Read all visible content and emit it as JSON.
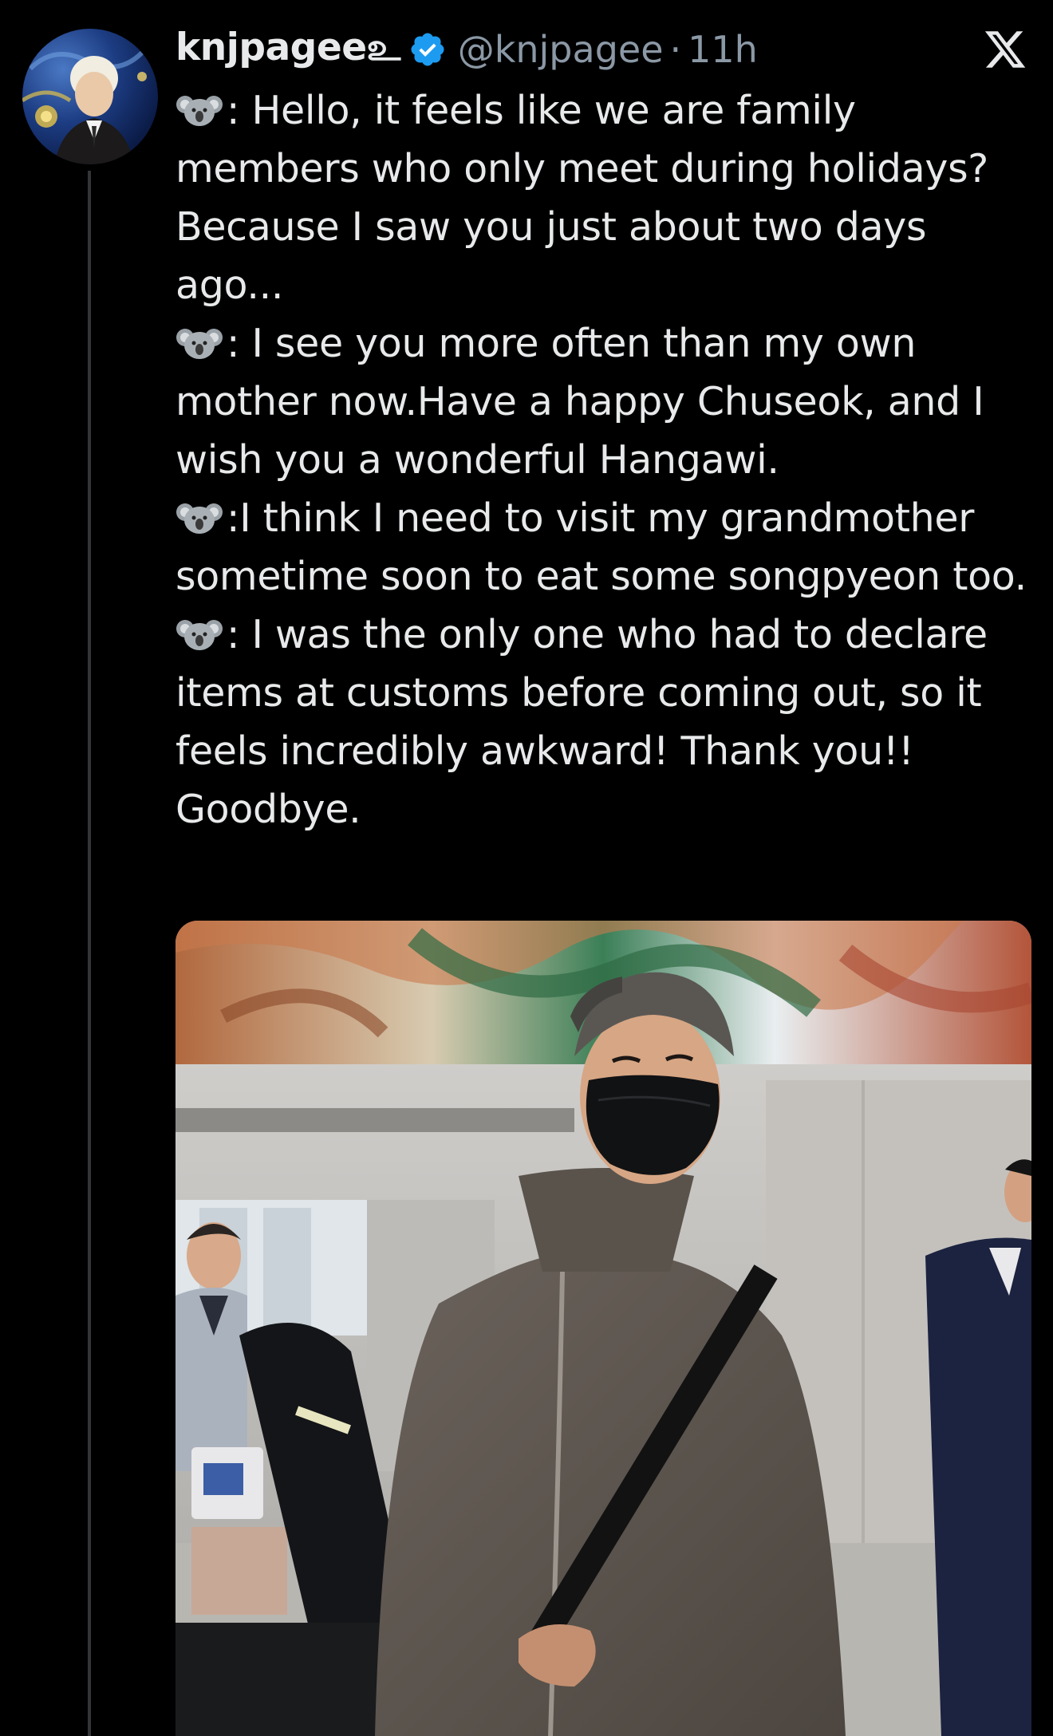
{
  "tweet": {
    "display_name": "knjpageeஉ",
    "handle": "@knjpagee",
    "separator": "·",
    "timestamp": "11h",
    "paragraphs": [
      {
        "emoji": "koala-face-icon",
        "text": ": Hello, it feels like we are family members who only meet during holidays? Because I saw you just about two days ago..."
      },
      {
        "emoji": "koala-face-icon",
        "text": ": I see you more often than my own mother now.Have a happy Chuseok, and I wish you a wonderful Hangawi."
      },
      {
        "emoji": "koala-face-icon",
        "text": ":I think I need to visit my grandmother sometime soon to eat some songpyeon too."
      },
      {
        "emoji": "koala-face-icon",
        "text": ": I was the only one who had to declare items at customs before coming out, so it feels incredibly awkward! Thank you!! Goodbye."
      }
    ]
  },
  "icons": {
    "avatar": "avatar",
    "verified": "verified-badge-icon",
    "platform": "x-logo-icon"
  },
  "colors": {
    "background": "#000000",
    "text_primary": "#e7e9ea",
    "text_secondary": "#8b98a5",
    "verified_blue": "#1d9bf0",
    "thread_line": "#333639"
  }
}
